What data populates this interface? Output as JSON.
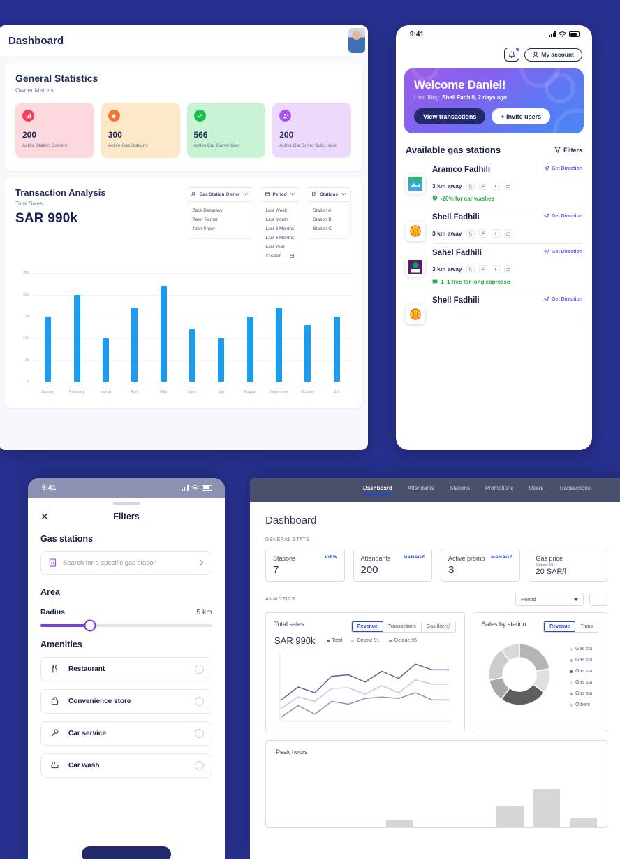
{
  "theme": {
    "background": "#27318f",
    "accent_blue": "#1a9cf0",
    "accent_purple": "#7c3aed",
    "nav_blue": "#2346d4"
  },
  "admin_dashboard": {
    "title": "Dashboard",
    "general": {
      "heading": "General Statistics",
      "subheading": "Owner Metrics",
      "cards": [
        {
          "value": "200",
          "label": "Active Station Owners",
          "bg": "#fcd9de",
          "icon_bg": "#f43f5e",
          "icon": "chart-icon"
        },
        {
          "value": "300",
          "label": "Active Gas Stations",
          "bg": "#fde9c8",
          "icon_bg": "#f97339",
          "icon": "fuel-icon"
        },
        {
          "value": "566",
          "label": "Active Car Owner User",
          "bg": "#c8f3d4",
          "icon_bg": "#1fbf4b",
          "icon": "check-icon"
        },
        {
          "value": "200",
          "label": "Active Car Driver Sub-Users",
          "bg": "#ecd9fb",
          "icon_bg": "#a855f7",
          "icon": "users-icon"
        }
      ]
    },
    "transaction": {
      "title": "Transaction Analysis",
      "subtitle": "Total Sales",
      "total": "SAR 990k",
      "filters": [
        {
          "label": "Gas Station Owner",
          "icon": "person-icon",
          "options": [
            "Zack Dempsey",
            "Peter Parker",
            "John Snow"
          ]
        },
        {
          "label": "Period",
          "icon": "calendar-icon",
          "options": [
            "Last Week",
            "Last Month",
            "Last 3 Months",
            "Last 6 Months",
            "Last Year",
            "Custom"
          ]
        },
        {
          "label": "Stations",
          "icon": "station-icon",
          "options": [
            "Station A",
            "Station B",
            "Station C"
          ]
        }
      ]
    },
    "chart_data": {
      "type": "bar",
      "title": "Transaction Analysis",
      "subtitle": "Total Sales",
      "categories": [
        "January",
        "February",
        "March",
        "April",
        "May",
        "June",
        "July",
        "August",
        "September",
        "October",
        "July"
      ],
      "values": [
        15000,
        20000,
        10000,
        17000,
        22000,
        12000,
        10000,
        15000,
        17000,
        13000,
        15000
      ],
      "ylabel": "",
      "xlabel": "",
      "ylim": [
        0,
        25000
      ],
      "yticks": [
        "0",
        "5k",
        "10k",
        "15k",
        "20k",
        "25k"
      ],
      "grid": true,
      "legend": "none",
      "series_color": "#1a9cf0"
    }
  },
  "phone_home": {
    "status": {
      "time": "9:41"
    },
    "account_button": "My account",
    "welcome": {
      "title": "Welcome Daniel!",
      "subtitle_prefix": "Last filling: ",
      "subtitle_value": "Shell Fadhili, 2 days ago",
      "primary_button": "View transactions",
      "secondary_button": "+ Invite users"
    },
    "list_header": "Available gas stations",
    "filters_label": "Filters",
    "direction_label": "Get Direction",
    "stations": [
      {
        "name": "Aramco Fadhili",
        "distance": "3 km away",
        "promo": "-20% for car washes",
        "promo_icon": "discount-icon",
        "logo": "aramco"
      },
      {
        "name": "Shell Fadhili",
        "distance": "3 km away",
        "promo": "",
        "promo_icon": "",
        "logo": "shell"
      },
      {
        "name": "Sahel Fadhili",
        "distance": "3 km away",
        "promo": "1+1 free for long espresso",
        "promo_icon": "gift-icon",
        "logo": "sahel"
      },
      {
        "name": "Shell Fadhili",
        "distance": "",
        "promo": "",
        "promo_icon": "",
        "logo": "shell"
      }
    ],
    "amenity_icons": [
      "restaurant-icon",
      "wrench-icon",
      "charger-icon",
      "carwash-icon"
    ]
  },
  "phone_filters": {
    "status": {
      "time": "9:41"
    },
    "title": "Filters",
    "gas_stations_heading": "Gas stations",
    "search_placeholder": "Search for a specific gas station",
    "area_heading": "Area",
    "radius_label": "Radius",
    "radius_value": "5 km",
    "amenities_heading": "Amenities",
    "amenities": [
      {
        "label": "Restaurant",
        "icon": "restaurant-icon"
      },
      {
        "label": "Convenience store",
        "icon": "basket-icon"
      },
      {
        "label": "Car service",
        "icon": "wrench-icon"
      },
      {
        "label": "Car wash",
        "icon": "carwash-icon"
      }
    ]
  },
  "station_dashboard": {
    "tabs": [
      {
        "label": "Dashboard",
        "active": true
      },
      {
        "label": "Attendants",
        "active": false
      },
      {
        "label": "Stations",
        "active": false
      },
      {
        "label": "Promotions",
        "active": false
      },
      {
        "label": "Users",
        "active": false
      },
      {
        "label": "Transactions",
        "active": false
      }
    ],
    "page_title": "Dashboard",
    "general_stats_label": "GENERAL STATS",
    "stats": [
      {
        "title": "Stations",
        "value": "7",
        "action": "VIEW"
      },
      {
        "title": "Attendants",
        "value": "200",
        "action": "MANAGE"
      },
      {
        "title": "Active promo",
        "value": "3",
        "action": "MANAGE"
      },
      {
        "title": "Gas price",
        "sub": "Octane 91",
        "value": "20 SAR/l",
        "action": ""
      }
    ],
    "analytics_label": "ANALYTICS",
    "period_select": "Period",
    "total_sales": {
      "title": "Total sales",
      "value": "SAR 990k",
      "segments": [
        {
          "label": "Revenue",
          "active": true
        },
        {
          "label": "Transactions",
          "active": false
        },
        {
          "label": "Gas (liters)",
          "active": false
        }
      ],
      "legend": [
        {
          "label": "Total",
          "color": "#5b6598"
        },
        {
          "label": "Octane 91",
          "color": "#c3c9e4"
        },
        {
          "label": "Octane 95",
          "color": "#8a93c2"
        }
      ]
    },
    "sales_by_station": {
      "title": "Sales by station",
      "segments": [
        {
          "label": "Revenue",
          "active": true
        },
        {
          "label": "Trans",
          "active": false
        }
      ],
      "legend": [
        {
          "label": "Gas sta",
          "color": "#d9d9d9"
        },
        {
          "label": "Gas sta",
          "color": "#b5b5b5"
        },
        {
          "label": "Gas sta",
          "color": "#5e5e5e"
        },
        {
          "label": "Gas sta",
          "color": "#e3e3e3"
        },
        {
          "label": "Gas sta",
          "color": "#a8a8a8"
        },
        {
          "label": "Others",
          "color": "#cdcdcd"
        }
      ]
    },
    "peak_hours_title": "Peak hours",
    "chart_data": [
      {
        "type": "line",
        "title": "Total sales",
        "xlabel": "",
        "ylabel": "",
        "x": [
          1,
          2,
          3,
          4,
          5,
          6,
          7,
          8,
          9,
          10,
          11
        ],
        "series": [
          {
            "name": "Total",
            "color": "#5b6598",
            "values": [
              30,
              48,
              40,
              63,
              65,
              55,
              70,
              60,
              80,
              72,
              72
            ]
          },
          {
            "name": "Octane 91",
            "color": "#c3c9e4",
            "values": [
              18,
              34,
              28,
              46,
              47,
              38,
              50,
              40,
              58,
              52,
              52
            ]
          },
          {
            "name": "Octane 95",
            "color": "#8a93c2",
            "values": [
              6,
              22,
              10,
              28,
              24,
              32,
              34,
              32,
              40,
              30,
              30
            ]
          }
        ]
      },
      {
        "type": "pie",
        "title": "Sales by station",
        "labels": [
          "Gas sta",
          "Gas sta",
          "Gas sta",
          "Gas sta",
          "Gas sta",
          "Others"
        ],
        "values": [
          22,
          13,
          25,
          12,
          18,
          10
        ],
        "colors": [
          "#b5b5b5",
          "#e0e0e0",
          "#5e5e5e",
          "#a8a8a8",
          "#cccccc",
          "#d9d9d9"
        ]
      },
      {
        "type": "bar",
        "title": "Peak hours",
        "categories": [
          "",
          "",
          "",
          "",
          "",
          "",
          "",
          "",
          ""
        ],
        "values": [
          0,
          0,
          0,
          14,
          0,
          0,
          42,
          75,
          18
        ],
        "color": "#d6d6d6"
      }
    ]
  }
}
